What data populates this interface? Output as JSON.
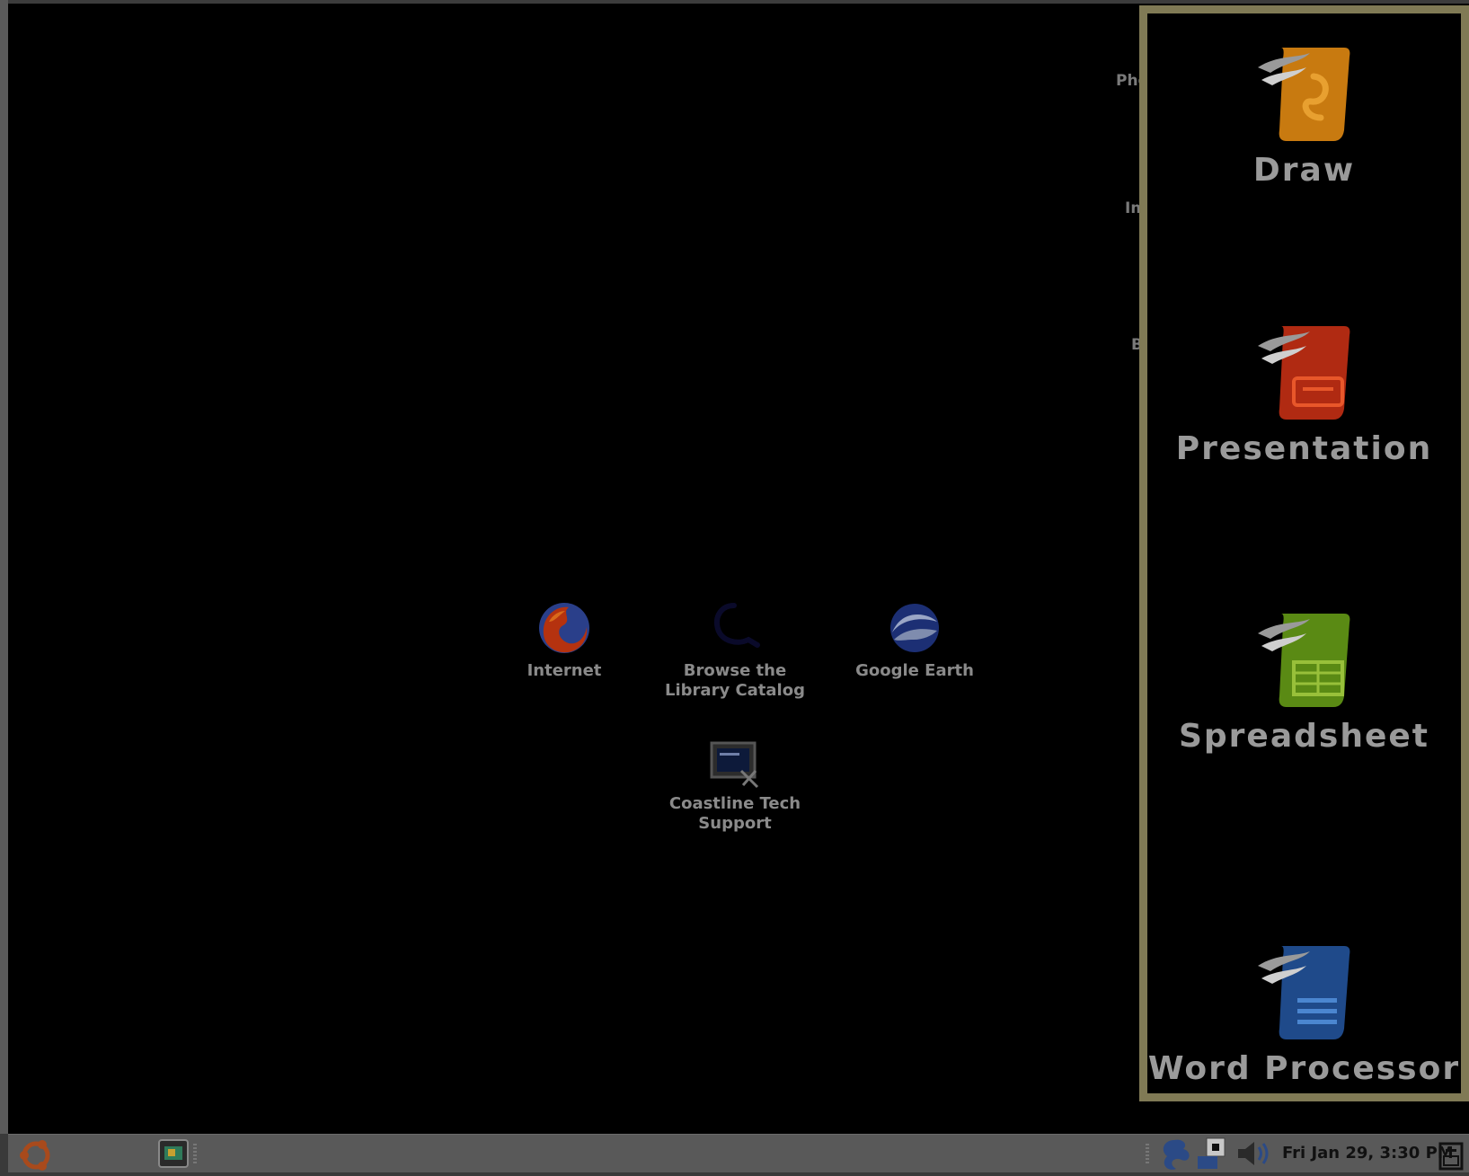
{
  "desktop": {
    "icons": [
      {
        "label": "Internet",
        "icon": "firefox-icon"
      },
      {
        "label": "Browse the\nLibrary Catalog",
        "icon": "library-catalog-icon"
      },
      {
        "label": "Google Earth",
        "icon": "google-earth-icon"
      },
      {
        "label": "Coastline Tech\nSupport",
        "icon": "tech-support-icon"
      }
    ],
    "partial_labels": [
      "Pho",
      "Im",
      "B"
    ]
  },
  "panel": {
    "border_color": "#807a55",
    "apps": [
      {
        "label": "Draw",
        "icon": "draw-icon",
        "color": "#d9891a"
      },
      {
        "label": "Presentation",
        "icon": "presentation-icon",
        "color": "#c23016"
      },
      {
        "label": "Spreadsheet",
        "icon": "spreadsheet-icon",
        "color": "#6b9e1c"
      },
      {
        "label": "Word Processor",
        "icon": "word-processor-icon",
        "color": "#2a5ea8"
      }
    ]
  },
  "taskbar": {
    "clock": "Fri Jan 29,  3:30 PM",
    "left_items": [
      "ubuntu-menu-icon",
      "window-button-icon"
    ],
    "tray": [
      "network-icon",
      "printer-icon",
      "volume-icon",
      "trash-icon"
    ]
  }
}
